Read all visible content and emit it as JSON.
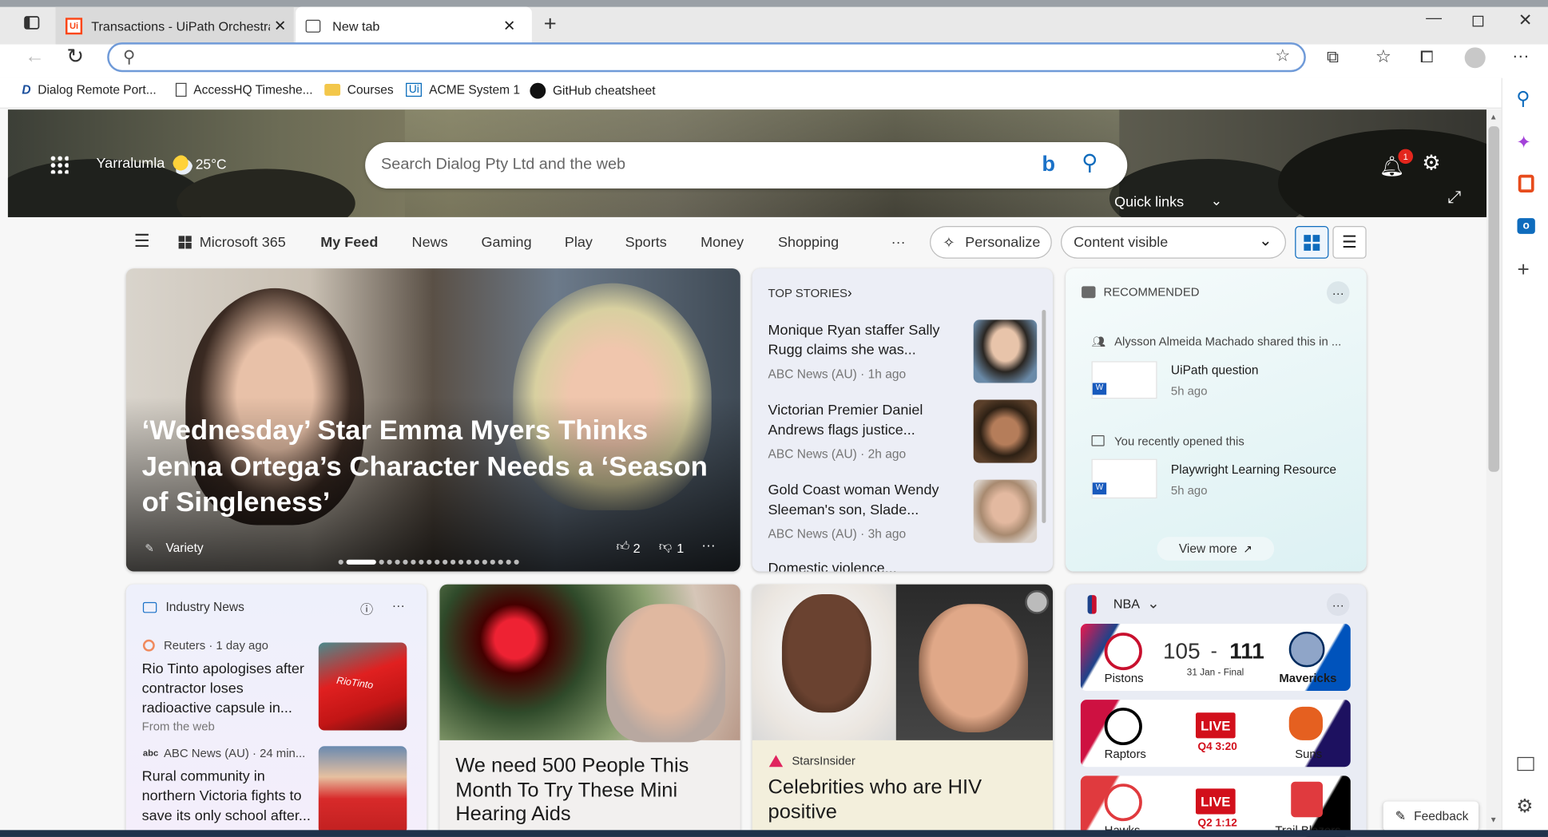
{
  "browser": {
    "tabs": [
      {
        "title": "Transactions - UiPath Orchestrat"
      },
      {
        "title": "New tab"
      }
    ],
    "address_value": "",
    "favorites": [
      "Dialog Remote Port...",
      "AccessHQ Timeshe...",
      "Courses",
      "ACME System 1",
      "GitHub cheatsheet"
    ]
  },
  "header": {
    "location": "Yarralumla",
    "temp": "25°C",
    "search_placeholder": "Search Dialog Pty Ltd and the web",
    "notif_count": "1",
    "quick_links": "Quick links"
  },
  "nav": {
    "items": [
      "Microsoft 365",
      "My Feed",
      "News",
      "Gaming",
      "Play",
      "Sports",
      "Money",
      "Shopping"
    ],
    "more": "···",
    "personalize": "Personalize",
    "content_visible": "Content visible"
  },
  "hero_story": {
    "title": "‘Wednesday’ Star Emma Myers Thinks Jenna Ortega’s Character Needs a ‘Season of Singleness’",
    "source": "Variety",
    "likes": "2",
    "dislikes": "1"
  },
  "top_stories": {
    "label": "TOP STORIES",
    "items": [
      {
        "title": "Monique Ryan staffer Sally Rugg claims she was...",
        "meta": "ABC News (AU) · 1h ago"
      },
      {
        "title": "Victorian Premier Daniel Andrews flags justice...",
        "meta": "ABC News (AU) · 2h ago"
      },
      {
        "title": "Gold Coast woman Wendy Sleeman's son, Slade...",
        "meta": "ABC News (AU) · 3h ago"
      },
      {
        "title": "Domestic violence..."
      }
    ]
  },
  "recommended": {
    "label": "RECOMMENDED",
    "shared": "Alysson Almeida Machado shared this in ...",
    "doc1": "UiPath question",
    "time1": "5h ago",
    "recent": "You recently opened this",
    "doc2": "Playwright Learning Resource",
    "time2": "5h ago",
    "view_more": "View more"
  },
  "industry": {
    "label": "Industry News",
    "items": [
      {
        "source": "Reuters · 1 day ago",
        "title": "Rio Tinto apologises after contractor loses radioactive capsule in...",
        "sub": "From the web"
      },
      {
        "source": "ABC News (AU) · 24 min...",
        "title": "Rural community in northern Victoria fights to save its only school after..."
      }
    ]
  },
  "ad1": {
    "title": "We need 500 People This Month To Try These Mini Hearing Aids"
  },
  "ad2": {
    "source": "StarsInsider",
    "title": "Celebrities who are HIV positive"
  },
  "nba": {
    "label": "NBA",
    "games": [
      {
        "home": "Pistons",
        "away": "Mavericks",
        "score_home": "105",
        "dash": "-",
        "score_away": "111",
        "status": "31 Jan - Final"
      },
      {
        "home": "Raptors",
        "away": "Suns",
        "live": "LIVE",
        "status": "Q4 3:20"
      },
      {
        "home": "Hawks",
        "away": "Trail Blazers",
        "live": "LIVE",
        "status": "Q2 1:12"
      }
    ]
  },
  "feedback": "Feedback",
  "colors": {
    "accent": "#0f6cbd",
    "live": "#d20f1b",
    "recommended_bg": "#e8f6f7"
  }
}
